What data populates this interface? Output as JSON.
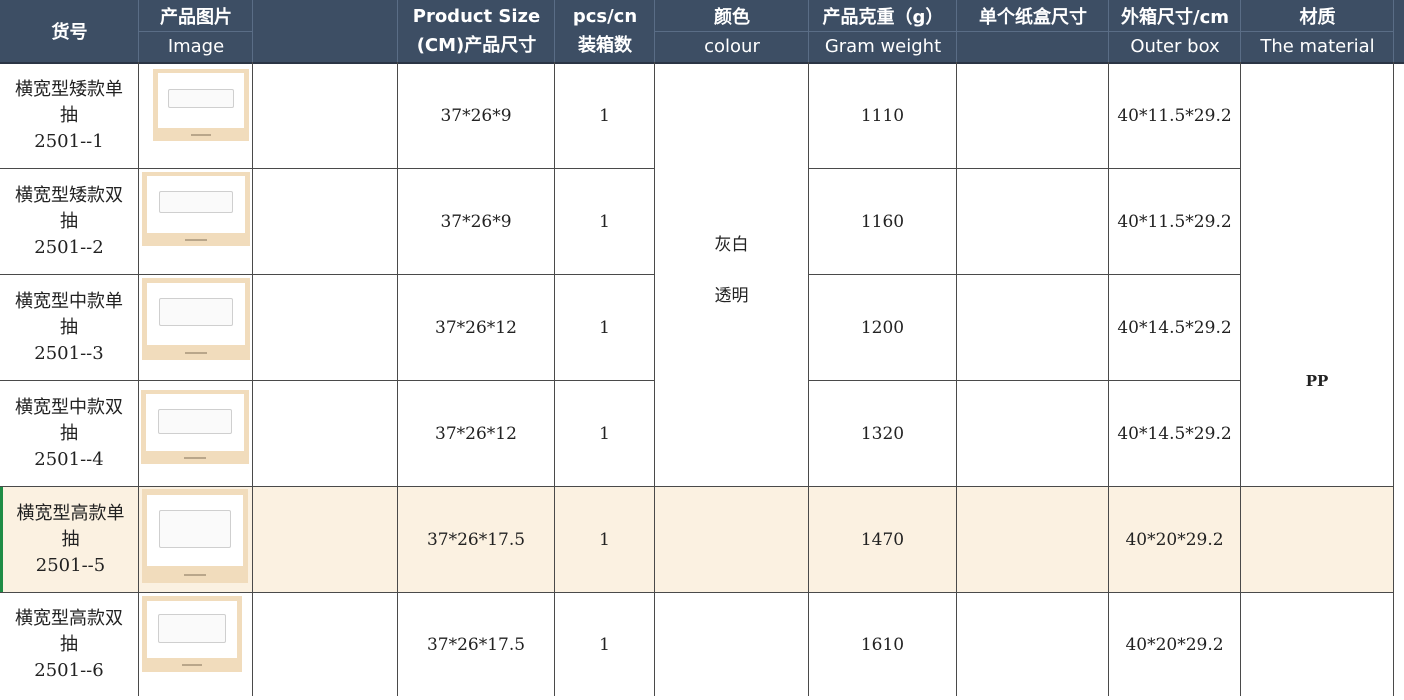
{
  "header": {
    "sku": "货号",
    "image_cn": "产品图片",
    "image_en": "Image",
    "size_line1": "Product Size",
    "size_line2": "(CM)产品尺寸",
    "pcs_line1": "pcs/cn",
    "pcs_line2": "装箱数",
    "colour_cn": "颜色",
    "colour_en": "colour",
    "weight_cn": "产品克重（g）",
    "weight_en": "Gram weight",
    "carton_cn": "单个纸盒尺寸",
    "outer_cn": "外箱尺寸/cm",
    "outer_en": "Outer box",
    "material_cn": "材质",
    "material_en": "The material"
  },
  "rows": [
    {
      "name1": "横宽型矮款单",
      "name2": "抽",
      "code": "2501--1",
      "size": "37*26*9",
      "pcs": "1",
      "weight": "1110",
      "outer": "40*11.5*29.2",
      "thumb_icon": "drawer-unit-thumbnail"
    },
    {
      "name1": "横宽型矮款双",
      "name2": "抽",
      "code": "2501--2",
      "size": "37*26*9",
      "pcs": "1",
      "weight": "1160",
      "outer": "40*11.5*29.2",
      "thumb_icon": "drawer-unit-thumbnail"
    },
    {
      "name1": "横宽型中款单",
      "name2": "抽",
      "code": "2501--3",
      "size": "37*26*12",
      "pcs": "1",
      "weight": "1200",
      "outer": "40*14.5*29.2",
      "thumb_icon": "drawer-unit-thumbnail"
    },
    {
      "name1": "横宽型中款双",
      "name2": "抽",
      "code": "2501--4",
      "size": "37*26*12",
      "pcs": "1",
      "weight": "1320",
      "outer": "40*14.5*29.2",
      "thumb_icon": "drawer-unit-thumbnail"
    },
    {
      "name1": "横宽型高款单",
      "name2": "抽",
      "code": "2501--5",
      "size": "37*26*17.5",
      "pcs": "1",
      "weight": "1470",
      "outer": "40*20*29.2",
      "thumb_icon": "drawer-unit-thumbnail"
    },
    {
      "name1": "横宽型高款双",
      "name2": "抽",
      "code": "2501--6",
      "size": "37*26*17.5",
      "pcs": "1",
      "weight": "1610",
      "outer": "40*20*29.2",
      "thumb_icon": "drawer-unit-thumbnail"
    }
  ],
  "merged": {
    "colour1": "灰白",
    "colour2": "透明",
    "material": "PP"
  },
  "colors": {
    "header_bg": "#3d4e64",
    "highlight_row": "#fbf1e1",
    "selection": "#1e8c45",
    "thumb_bg": "#f1dcbc"
  }
}
